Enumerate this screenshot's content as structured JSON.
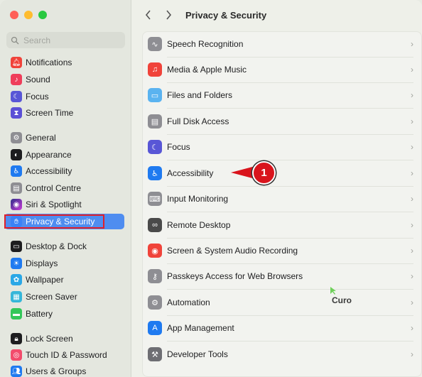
{
  "window": {
    "title": "Privacy & Security"
  },
  "search": {
    "placeholder": "Search"
  },
  "sidebar": {
    "items": [
      {
        "label": "Notifications",
        "icon": "bell-icon",
        "color": "#f0433a"
      },
      {
        "label": "Sound",
        "icon": "speaker-icon",
        "color": "#ef3e5a"
      },
      {
        "label": "Focus",
        "icon": "moon-icon",
        "color": "#5856d6"
      },
      {
        "label": "Screen Time",
        "icon": "hourglass-icon",
        "color": "#5b50d6"
      },
      {
        "label": "General",
        "icon": "gear-icon",
        "color": "#8e8e93"
      },
      {
        "label": "Appearance",
        "icon": "appearance-icon",
        "color": "#1d1d1f"
      },
      {
        "label": "Accessibility",
        "icon": "accessibility-icon",
        "color": "#1f7af0"
      },
      {
        "label": "Control Centre",
        "icon": "control-centre-icon",
        "color": "#8e8e93"
      },
      {
        "label": "Siri & Spotlight",
        "icon": "siri-icon",
        "color": "#2f2f8a"
      },
      {
        "label": "Privacy & Security",
        "icon": "hand-icon",
        "color": "#3b82f6"
      },
      {
        "label": "Desktop & Dock",
        "icon": "dock-icon",
        "color": "#1d1d1f"
      },
      {
        "label": "Displays",
        "icon": "sun-icon",
        "color": "#1f7af0"
      },
      {
        "label": "Wallpaper",
        "icon": "flower-icon",
        "color": "#2aa7e6"
      },
      {
        "label": "Screen Saver",
        "icon": "screensaver-icon",
        "color": "#35b6d9"
      },
      {
        "label": "Battery",
        "icon": "battery-icon",
        "color": "#34c759"
      },
      {
        "label": "Lock Screen",
        "icon": "lock-icon",
        "color": "#1d1d1f"
      },
      {
        "label": "Touch ID & Password",
        "icon": "fingerprint-icon",
        "color": "#f24c6c"
      },
      {
        "label": "Users & Groups",
        "icon": "users-icon",
        "color": "#1f7af0"
      }
    ]
  },
  "main": {
    "rows": [
      {
        "label": "Speech Recognition",
        "icon": "waveform-icon",
        "color": "#8e8e93"
      },
      {
        "label": "Media & Apple Music",
        "icon": "music-note-icon",
        "color": "#f0433a"
      },
      {
        "label": "Files and Folders",
        "icon": "folder-icon",
        "color": "#5ab3f0"
      },
      {
        "label": "Full Disk Access",
        "icon": "disk-icon",
        "color": "#8e8e93"
      },
      {
        "label": "Focus",
        "icon": "moon-icon",
        "color": "#5856d6"
      },
      {
        "label": "Accessibility",
        "icon": "accessibility-icon",
        "color": "#1f7af0"
      },
      {
        "label": "Input Monitoring",
        "icon": "keyboard-icon",
        "color": "#8e8e93"
      },
      {
        "label": "Remote Desktop",
        "icon": "binoculars-icon",
        "color": "#4a4a4a"
      },
      {
        "label": "Screen & System Audio Recording",
        "icon": "record-icon",
        "color": "#f0433a"
      },
      {
        "label": "Passkeys Access for Web Browsers",
        "icon": "passkey-icon",
        "color": "#8e8e93"
      },
      {
        "label": "Automation",
        "icon": "gears-icon",
        "color": "#8e8e93"
      },
      {
        "label": "App Management",
        "icon": "app-store-icon",
        "color": "#1f7af0"
      },
      {
        "label": "Developer Tools",
        "icon": "hammer-icon",
        "color": "#6e6e73"
      }
    ]
  },
  "annotation": {
    "step_number": "1",
    "cursor_label": "Curo"
  }
}
